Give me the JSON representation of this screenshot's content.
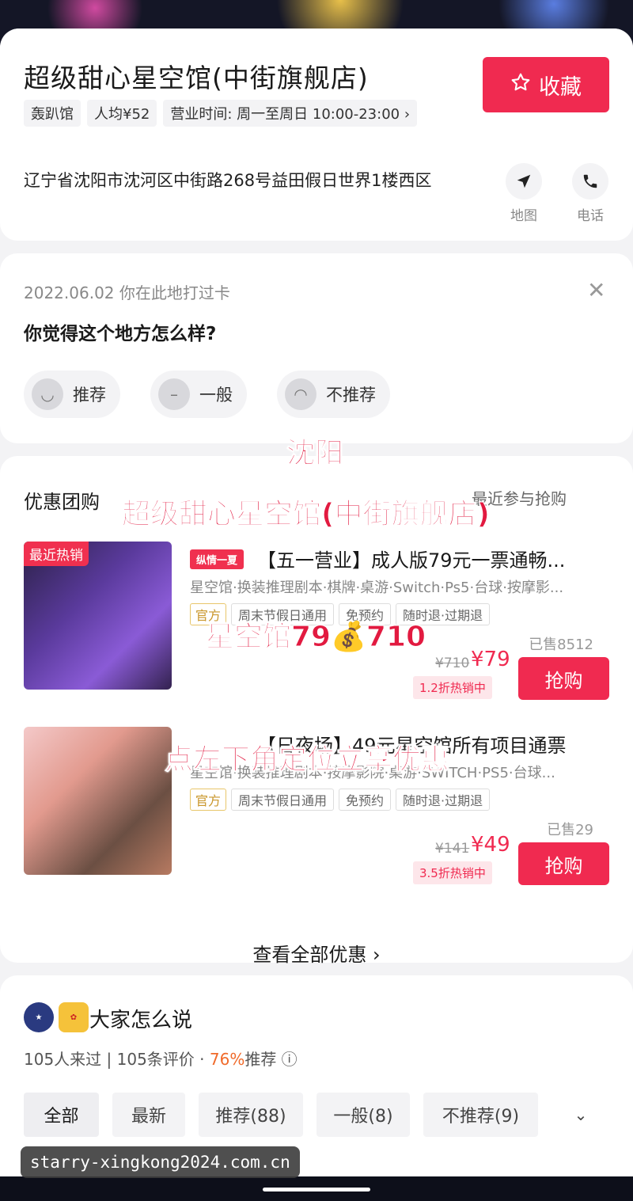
{
  "store": {
    "name": "超级甜心星空馆(中街旗舰店)",
    "tags": [
      "轰趴馆",
      "人均¥52",
      "营业时间: 周一至周日 10:00-23:00 ›"
    ],
    "favorite_label": "收藏",
    "address": "辽宁省沈阳市沈河区中街路268号益田假日世界1楼西区",
    "map_label": "地图",
    "phone_label": "电话"
  },
  "checkin": {
    "date_text": "2022.06.02 你在此地打过卡",
    "question": "你觉得这个地方怎么样?",
    "options": [
      "推荐",
      "一般",
      "不推荐"
    ]
  },
  "deals": {
    "title": "优惠团购",
    "recent": "最近参与抢购",
    "items": [
      {
        "hot_badge": "最近热销",
        "mini_badge": "纵情一夏",
        "name": "【五一营业】成人版79元一票通畅...",
        "sub": "星空馆·换装推理剧本·棋牌·桌游·Switch·Ps5·台球·按摩影...",
        "official": "官方",
        "tags": [
          "周末节假日通用",
          "免预约",
          "随时退·过期退"
        ],
        "sold": "已售8512",
        "price_old": "¥710",
        "price_now": "¥79",
        "discount": "1.2折热销中",
        "buy": "抢购"
      },
      {
        "hot_badge": "",
        "mini_badge": "",
        "name": "【日夜场】49元星空馆所有项目通票",
        "sub": "星空馆·换装推理剧本·按摩影院·桌游·SWITCH·PS5·台球...",
        "official": "官方",
        "tags": [
          "周末节假日通用",
          "免预约",
          "随时退·过期退"
        ],
        "sold": "已售29",
        "price_old": "¥141",
        "price_now": "¥49",
        "discount": "3.5折热销中",
        "buy": "抢购"
      }
    ],
    "view_all": "查看全部优惠 ›"
  },
  "reviews": {
    "title": "大家怎么说",
    "stats_prefix": "105人来过 | 105条评价 · ",
    "stats_pct": "76%",
    "stats_suffix": "推荐 ⓘ",
    "filters": [
      "全部",
      "最新",
      "推荐(88)",
      "一般(8)",
      "不推荐(9)"
    ]
  },
  "overlays": {
    "city": "沈阳",
    "store": "超级甜心星空馆(中街旗舰店)",
    "price": "星空馆79💰710",
    "tip": "点左下角定位立享优惠"
  },
  "watermark_url": "starry-xingkong2024.com.cn",
  "colors": {
    "accent": "#f02a50",
    "orange": "#f06a2a"
  },
  "icons": [
    "star-icon",
    "navigate-icon",
    "phone-icon",
    "close-icon",
    "smile-face-icon",
    "neutral-face-icon",
    "sad-face-icon",
    "chevron-right-icon",
    "chevron-down-icon",
    "info-icon"
  ]
}
